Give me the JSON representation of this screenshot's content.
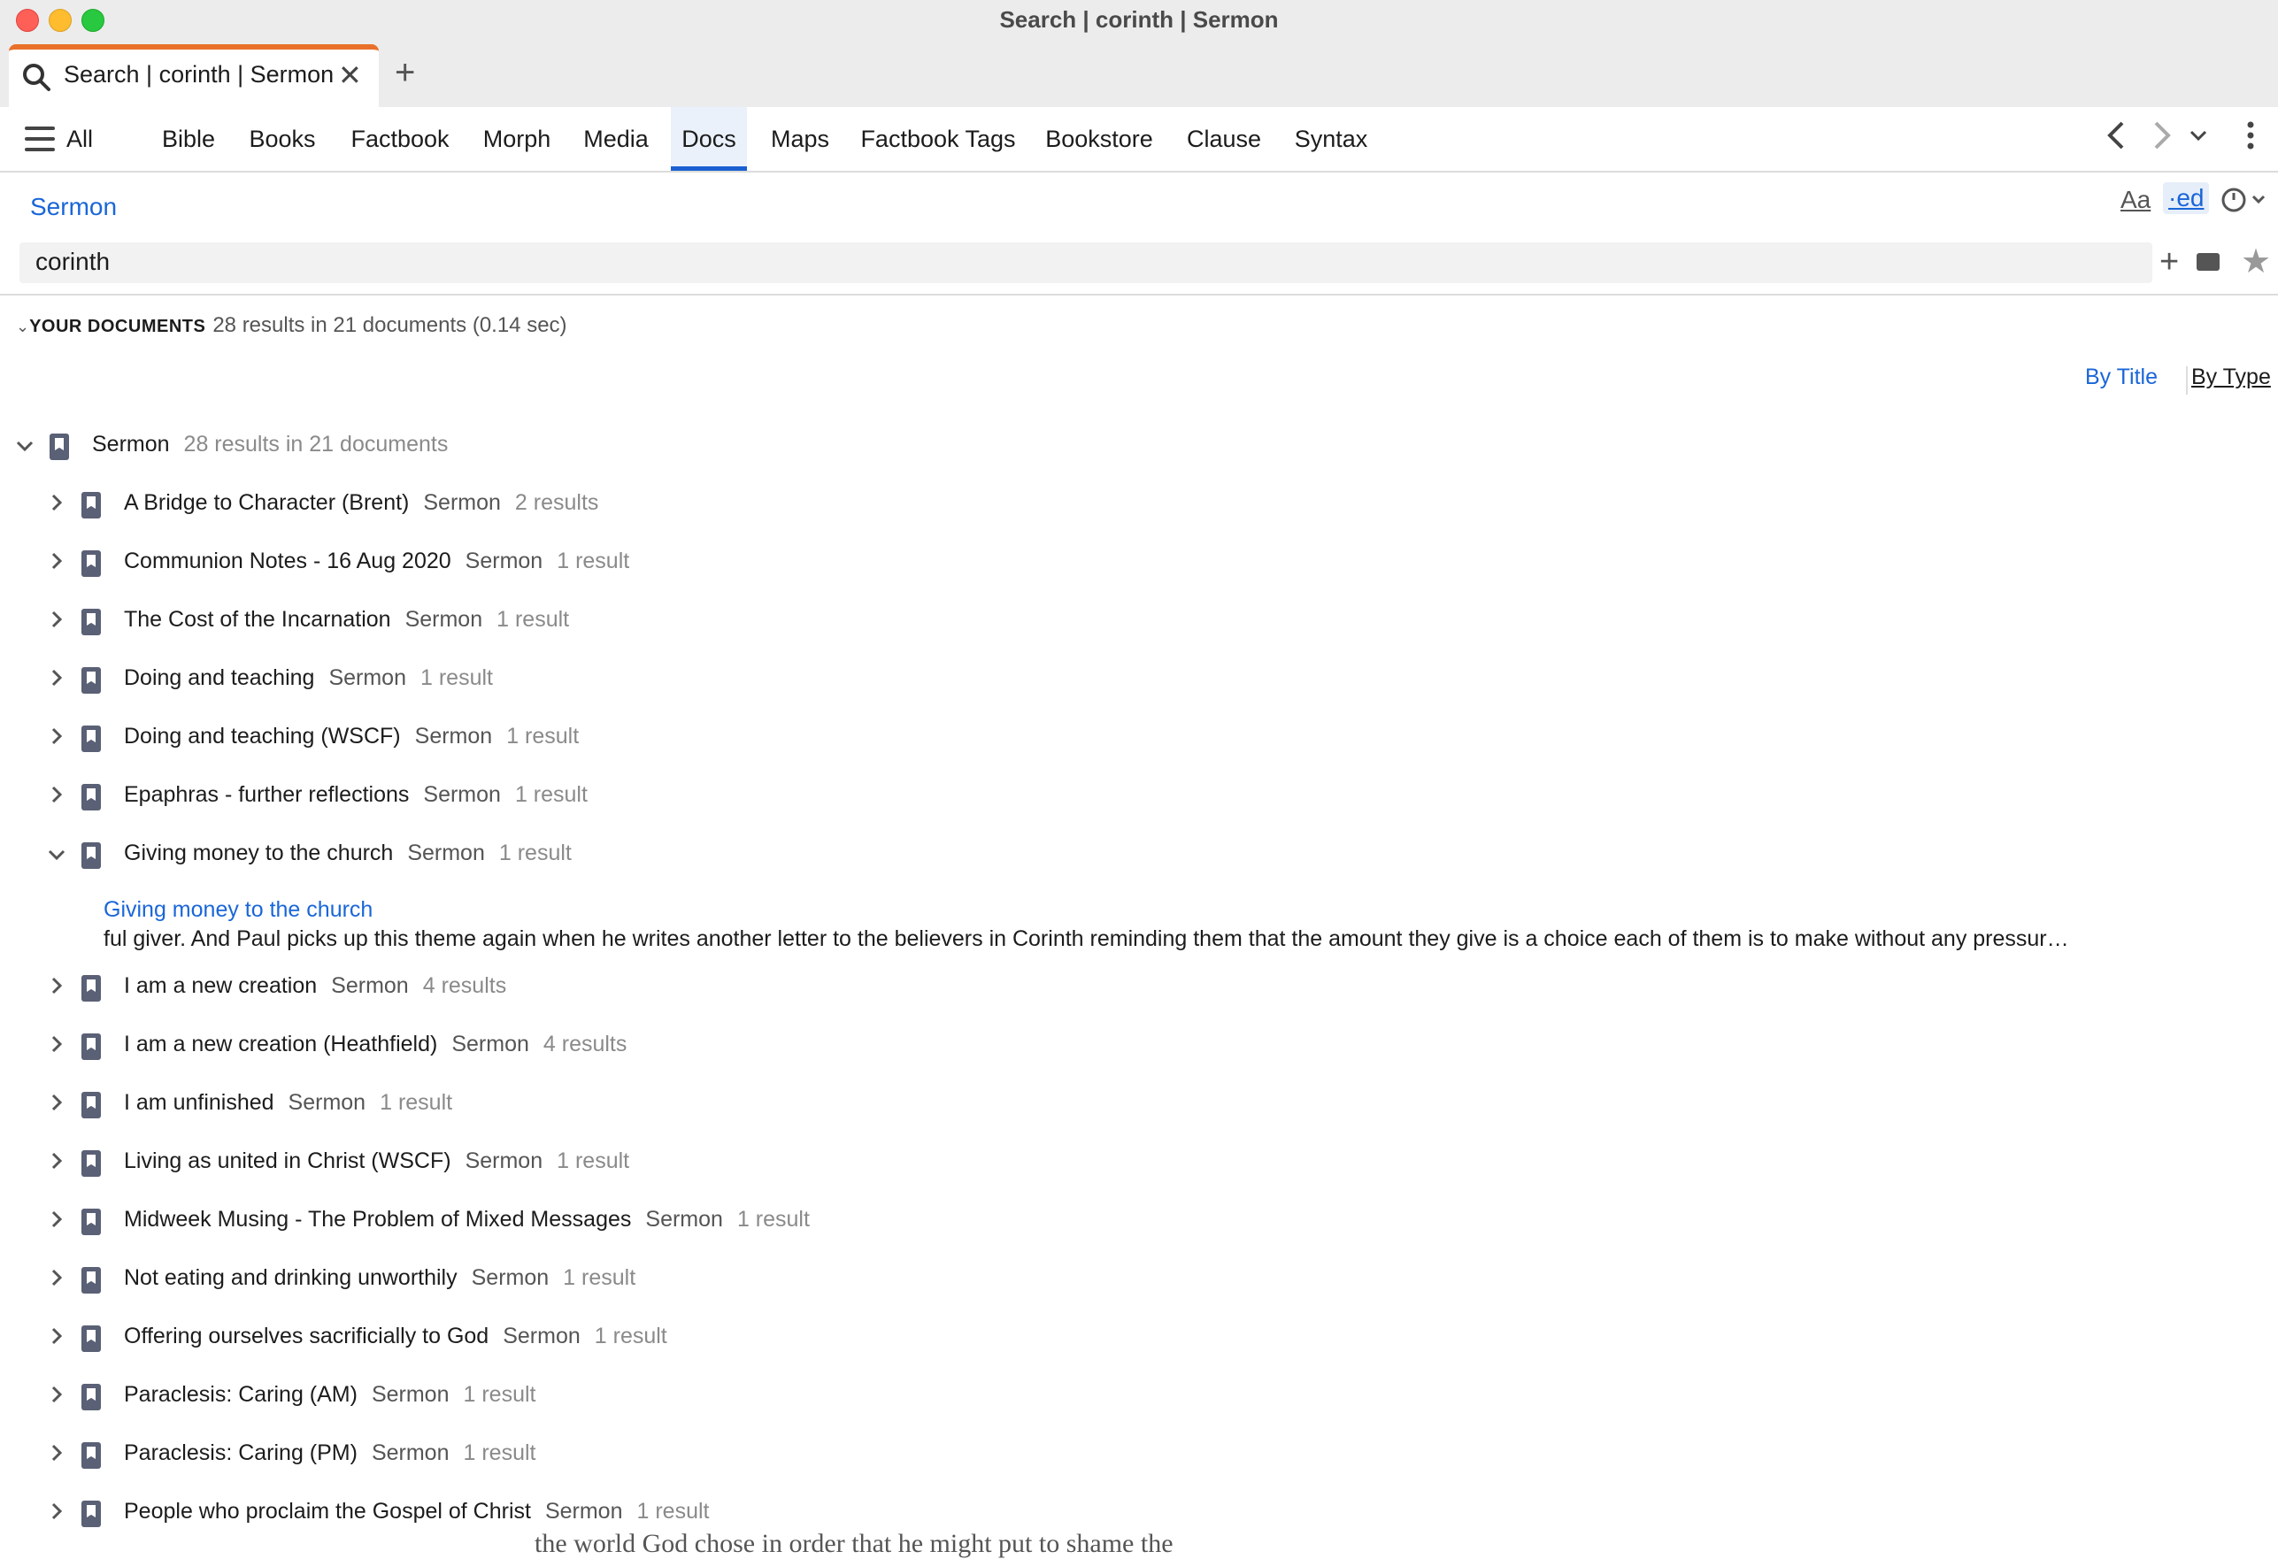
{
  "window": {
    "title": "Search | corinth | Sermon"
  },
  "tab": {
    "label": "Search | corinth | Sermon",
    "close": "✕",
    "new_tab": "+"
  },
  "nav": {
    "items": [
      "All",
      "Bible",
      "Books",
      "Factbook",
      "Morph",
      "Media",
      "Docs",
      "Maps",
      "Factbook Tags",
      "Bookstore",
      "Clause",
      "Syntax"
    ],
    "active": "Docs"
  },
  "filter": {
    "label": "Sermon"
  },
  "toolbar": {
    "font_btn": "Aa",
    "ed_btn": "·ed"
  },
  "search": {
    "value": "corinth"
  },
  "results_header": {
    "label": "YOUR DOCUMENTS",
    "summary": "28 results in 21 documents (0.14 sec)"
  },
  "sort": {
    "by_title": "By Title",
    "by_type": "By Type"
  },
  "group": {
    "title": "Sermon",
    "summary": "28 results in 21 documents"
  },
  "documents": [
    {
      "title": "A Bridge to Character (Brent)",
      "type": "Sermon",
      "count": "2 results"
    },
    {
      "title": "Communion Notes - 16 Aug 2020",
      "type": "Sermon",
      "count": "1 result"
    },
    {
      "title": "The Cost of the Incarnation",
      "type": "Sermon",
      "count": "1 result"
    },
    {
      "title": "Doing and teaching",
      "type": "Sermon",
      "count": "1 result"
    },
    {
      "title": "Doing and teaching (WSCF)",
      "type": "Sermon",
      "count": "1 result"
    },
    {
      "title": "Epaphras - further reflections",
      "type": "Sermon",
      "count": "1 result"
    },
    {
      "title": "Giving money to the church",
      "type": "Sermon",
      "count": "1 result",
      "expanded": true
    },
    {
      "title": "I am a new creation",
      "type": "Sermon",
      "count": "4 results"
    },
    {
      "title": "I am a new creation (Heathfield)",
      "type": "Sermon",
      "count": "4 results"
    },
    {
      "title": "I am unfinished",
      "type": "Sermon",
      "count": "1 result"
    },
    {
      "title": "Living as united in Christ (WSCF)",
      "type": "Sermon",
      "count": "1 result"
    },
    {
      "title": "Midweek Musing - The Problem of Mixed Messages",
      "type": "Sermon",
      "count": "1 result"
    },
    {
      "title": "Not eating and drinking unworthily",
      "type": "Sermon",
      "count": "1 result"
    },
    {
      "title": "Offering ourselves sacrificially to God",
      "type": "Sermon",
      "count": "1 result"
    },
    {
      "title": "Paraclesis: Caring (AM)",
      "type": "Sermon",
      "count": "1 result"
    },
    {
      "title": "Paraclesis: Caring (PM)",
      "type": "Sermon",
      "count": "1 result"
    },
    {
      "title": "People who proclaim the Gospel of Christ",
      "type": "Sermon",
      "count": "1 result"
    }
  ],
  "snippet": {
    "title": "Giving money to the church",
    "text": "ful giver. And Paul picks up this theme again when he writes another letter to the believers in Corinth reminding them that the amount they give is a choice each of them is to make without any pressur…"
  },
  "background_peek": "the world God chose in order that he might put to shame the",
  "colors": {
    "accent": "#1a66d8",
    "tab_accent": "#e8702a",
    "doc_icon": "#5a6075"
  }
}
